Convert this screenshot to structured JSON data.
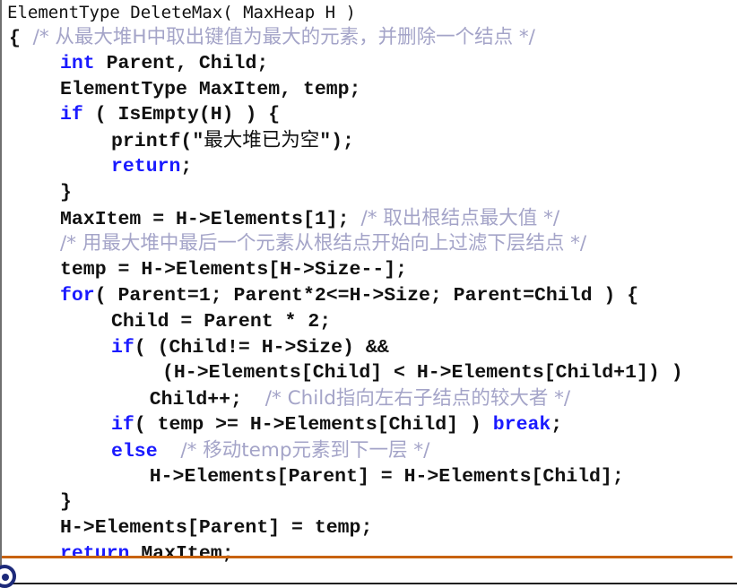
{
  "slide": {
    "signature": "ElementType DeleteMax( MaxHeap H )",
    "lines": [
      {
        "indent": 0,
        "parts": [
          {
            "t": "{",
            "c": "n"
          },
          {
            "t": "  /* 从最大堆H中取出键值为最大的元素，并删除一个结点 */",
            "c": "cm"
          }
        ]
      },
      {
        "indent": 1,
        "parts": [
          {
            "t": "int",
            "c": "kw"
          },
          {
            "t": " Parent, Child;",
            "c": "n"
          }
        ]
      },
      {
        "indent": 1,
        "parts": [
          {
            "t": "ElementType MaxItem, temp;",
            "c": "n"
          }
        ]
      },
      {
        "indent": 1,
        "parts": [
          {
            "t": "if",
            "c": "kw"
          },
          {
            "t": " ( IsEmpty(H) ) {",
            "c": "n"
          }
        ]
      },
      {
        "indent": 2,
        "parts": [
          {
            "t": "printf(\"",
            "c": "n"
          },
          {
            "t": "最大堆已为空",
            "c": "cjk"
          },
          {
            "t": "\");",
            "c": "n"
          }
        ]
      },
      {
        "indent": 2,
        "parts": [
          {
            "t": "return",
            "c": "kw"
          },
          {
            "t": ";",
            "c": "n"
          }
        ]
      },
      {
        "indent": 1,
        "parts": [
          {
            "t": "}",
            "c": "n"
          }
        ]
      },
      {
        "indent": 1,
        "parts": [
          {
            "t": "MaxItem = H->Elements[1]; ",
            "c": "n"
          },
          {
            "t": "/* 取出根结点最大值 */",
            "c": "cm"
          }
        ]
      },
      {
        "indent": 1,
        "parts": [
          {
            "t": "/* 用最大堆中最后一个元素从根结点开始向上过滤下层结点 */",
            "c": "cm"
          }
        ]
      },
      {
        "indent": 1,
        "parts": [
          {
            "t": "temp = H->Elements[H->Size--];",
            "c": "n"
          }
        ]
      },
      {
        "indent": 1,
        "parts": [
          {
            "t": "for",
            "c": "kw"
          },
          {
            "t": "( Parent=1; Parent*2<=H->Size; Parent=Child ) {",
            "c": "n"
          }
        ]
      },
      {
        "indent": 2,
        "parts": [
          {
            "t": "Child = Parent * 2;",
            "c": "n"
          }
        ]
      },
      {
        "indent": 2,
        "parts": [
          {
            "t": "if",
            "c": "kw"
          },
          {
            "t": "( (Child!= H->Size) &&",
            "c": "n"
          }
        ]
      },
      {
        "indent": 3,
        "parts": [
          {
            "t": "(H->Elements[Child] < H->Elements[Child+1]) )",
            "c": "n"
          }
        ]
      },
      {
        "indent": 2.75,
        "parts": [
          {
            "t": "Child++;  ",
            "c": "n"
          },
          {
            "t": "/* Child指向左右子结点的较大者 */",
            "c": "cm"
          }
        ]
      },
      {
        "indent": 2,
        "parts": [
          {
            "t": "if",
            "c": "kw"
          },
          {
            "t": "( temp >= H->Elements[Child] ) ",
            "c": "n"
          },
          {
            "t": "break",
            "c": "kw"
          },
          {
            "t": ";",
            "c": "n"
          }
        ]
      },
      {
        "indent": 2,
        "parts": [
          {
            "t": "else",
            "c": "kw"
          },
          {
            "t": "  ",
            "c": "n"
          },
          {
            "t": "/* 移动temp元素到下一层 */",
            "c": "cm"
          }
        ]
      },
      {
        "indent": 2.75,
        "parts": [
          {
            "t": "H->Elements[Parent] = H->Elements[Child];",
            "c": "n"
          }
        ]
      },
      {
        "indent": 1,
        "parts": [
          {
            "t": "}",
            "c": "n"
          }
        ]
      },
      {
        "indent": 1,
        "parts": [
          {
            "t": "H->Elements[Parent] = temp;",
            "c": "n"
          }
        ]
      },
      {
        "indent": 1,
        "parts": [
          {
            "t": "return",
            "c": "kw"
          },
          {
            "t": " MaxItem;",
            "c": "n"
          }
        ]
      }
    ]
  },
  "colors": {
    "keyword": "#1a1aff",
    "comment": "#a4a4c8",
    "text": "#111111",
    "rule": "#c8620a"
  },
  "icons": {
    "logo": "partial-circle-logo"
  }
}
